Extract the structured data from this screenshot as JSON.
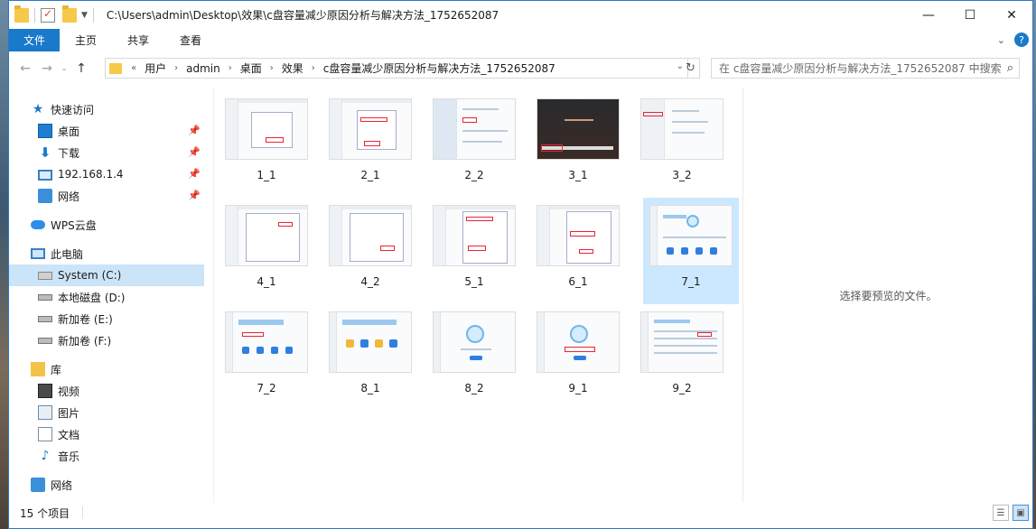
{
  "window": {
    "title": "C:\\Users\\admin\\Desktop\\效果\\c盘容量减少原因分析与解决方法_1752652087",
    "controls": {
      "minimize": "—",
      "maximize": "☐",
      "close": "✕"
    }
  },
  "ribbon": {
    "tabs": [
      "文件",
      "主页",
      "共享",
      "查看"
    ]
  },
  "address": {
    "overflow": "«",
    "crumbs": [
      "用户",
      "admin",
      "桌面",
      "效果",
      "c盘容量减少原因分析与解决方法_1752652087"
    ],
    "search_placeholder": "在 c盘容量减少原因分析与解决方法_1752652087 中搜索"
  },
  "sidebar": {
    "quick_access": "快速访问",
    "pinned": [
      "桌面",
      "下载",
      "192.168.1.4",
      "网络"
    ],
    "wps": "WPS云盘",
    "this_pc": "此电脑",
    "drives": [
      "System (C:)",
      "本地磁盘 (D:)",
      "新加卷 (E:)",
      "新加卷 (F:)"
    ],
    "library": "库",
    "libraries": [
      "视频",
      "图片",
      "文档",
      "音乐"
    ],
    "network": "网络"
  },
  "files": [
    {
      "name": "1_1"
    },
    {
      "name": "2_1"
    },
    {
      "name": "2_2"
    },
    {
      "name": "3_1"
    },
    {
      "name": "3_2"
    },
    {
      "name": "4_1"
    },
    {
      "name": "4_2"
    },
    {
      "name": "5_1"
    },
    {
      "name": "6_1"
    },
    {
      "name": "7_1"
    },
    {
      "name": "7_2"
    },
    {
      "name": "8_1"
    },
    {
      "name": "8_2"
    },
    {
      "name": "9_1"
    },
    {
      "name": "9_2"
    }
  ],
  "selected_file": "7_1",
  "preview": {
    "message": "选择要预览的文件。"
  },
  "status": {
    "count": "15 个项目"
  },
  "colors": {
    "accent": "#1979ca",
    "selection": "#cce8ff"
  }
}
